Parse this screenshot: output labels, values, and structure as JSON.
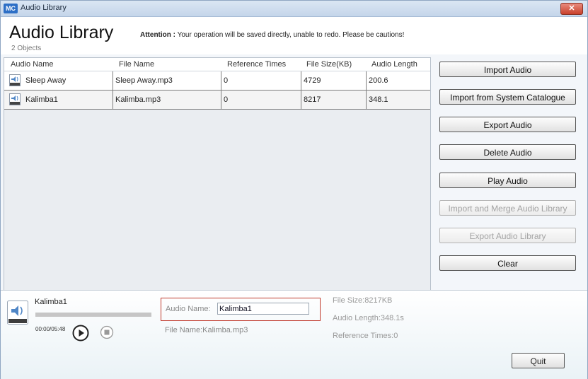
{
  "window": {
    "app_icon": "MC",
    "title": "Audio Library",
    "close_label": "✕"
  },
  "header": {
    "title": "Audio Library",
    "count": "2 Objects",
    "attention_label": "Attention :",
    "attention_text": " Your operation will be saved directly, unable to redo. Please be cautions!"
  },
  "table": {
    "columns": [
      "Audio Name",
      "File Name",
      "Reference Times",
      "File Size(KB)",
      "Audio Length"
    ],
    "rows": [
      {
        "audio_name": "Sleep Away",
        "file_name": "Sleep Away.mp3",
        "reference_times": "0",
        "file_size": "4729",
        "audio_length": "200.6"
      },
      {
        "audio_name": "Kalimba1",
        "file_name": "Kalimba.mp3",
        "reference_times": "0",
        "file_size": "8217",
        "audio_length": "348.1"
      }
    ]
  },
  "buttons": {
    "import_audio": "Import Audio",
    "import_system": "Import from System Catalogue",
    "export_audio": "Export Audio",
    "delete_audio": "Delete Audio",
    "play_audio": "Play Audio",
    "import_merge": "Import and Merge Audio Library",
    "export_library": "Export Audio Library",
    "clear": "Clear",
    "quit": "Quit"
  },
  "player": {
    "track_name": "Kalimba1",
    "time": "00:00/05:48",
    "progress": 0
  },
  "details": {
    "audio_name_label": "Audio Name:",
    "audio_name_value": "Kalimba1",
    "file_name": "File Name:Kalimba.mp3",
    "file_size": "File Size:8217KB",
    "audio_length": "Audio Length:348.1s",
    "reference_times": "Reference Times:0"
  },
  "icons": {
    "app": "app-logo-icon",
    "audio_file": "audio-file-icon",
    "play": "play-icon",
    "stop": "stop-icon"
  },
  "colors": {
    "title_bar": "#c4d5ea",
    "close_button": "#c9412c",
    "highlight_border": "#c0392b",
    "selection": "#3a78c9"
  }
}
